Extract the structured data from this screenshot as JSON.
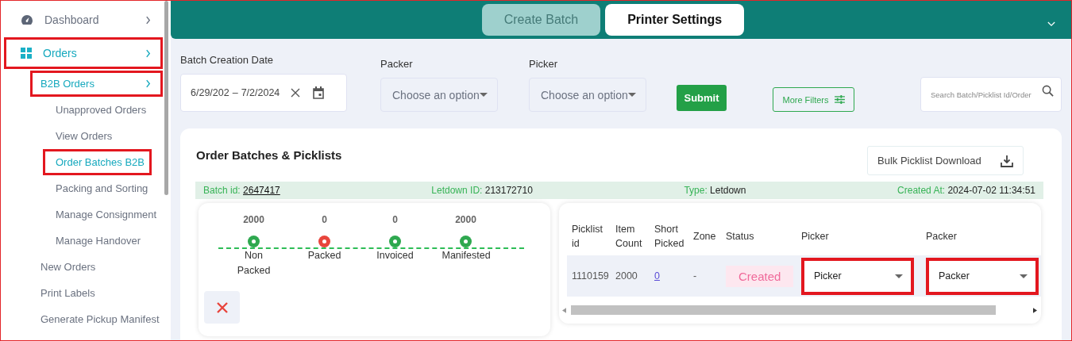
{
  "sidebar": {
    "items": [
      {
        "label": "Dashboard",
        "kind": "gauge",
        "selected": false,
        "highlighted": false,
        "expandable": true
      },
      {
        "label": "Orders",
        "kind": "grid",
        "selected": true,
        "highlighted": true,
        "expandable": true,
        "children": [
          {
            "label": "B2B Orders",
            "selected": true,
            "highlighted": true,
            "expandable": true,
            "children": [
              {
                "label": "Unapproved Orders",
                "selected": false,
                "highlighted": false,
                "expandable": false
              },
              {
                "label": "View Orders",
                "selected": false,
                "highlighted": false,
                "expandable": false
              },
              {
                "label": "Order Batches B2B",
                "selected": true,
                "highlighted": true,
                "expandable": false
              },
              {
                "label": "Packing and Sorting",
                "selected": false,
                "highlighted": false,
                "expandable": false
              },
              {
                "label": "Manage Consignment",
                "selected": false,
                "highlighted": false,
                "expandable": false
              },
              {
                "label": "Manage Handover",
                "selected": false,
                "highlighted": false,
                "expandable": false
              }
            ]
          },
          {
            "label": "New Orders",
            "selected": false,
            "highlighted": false,
            "expandable": false
          },
          {
            "label": "Print Labels",
            "selected": false,
            "highlighted": false,
            "expandable": false
          },
          {
            "label": "Generate Pickup Manifest",
            "selected": false,
            "highlighted": false,
            "expandable": false
          }
        ]
      }
    ]
  },
  "header": {
    "tabs": [
      {
        "label": "Create Batch",
        "selected": false
      },
      {
        "label": "Printer Settings",
        "selected": true
      }
    ]
  },
  "filters": {
    "date_range": {
      "label": "Batch Creation Date",
      "start": "6/29/202",
      "separator": "–",
      "end": "7/2/2024"
    },
    "packer": {
      "label": "Packer",
      "placeholder": "Choose an option"
    },
    "picker": {
      "label": "Picker",
      "placeholder": "Choose an option"
    },
    "submit": "Submit",
    "more_filters": "More Filters",
    "search": {
      "placeholder": "Search Batch/Picklist Id/Order"
    }
  },
  "card": {
    "title": "Order Batches & Picklists",
    "bulk_download": "Bulk Picklist Download",
    "batch_info": [
      {
        "label": "Batch id:",
        "value": "2647417",
        "kind": "link"
      },
      {
        "label": "Letdown ID:",
        "value": "213172710",
        "kind": "text"
      },
      {
        "label": "Type:",
        "value": "Letdown",
        "kind": "text"
      },
      {
        "label": "Created At:",
        "value": "2024-07-02 11:34:51",
        "kind": "text"
      }
    ],
    "stages": [
      {
        "count": "2000",
        "label": "Non Packed",
        "color": "#2ea84f"
      },
      {
        "count": "0",
        "label": "Packed",
        "color": "#e8453c"
      },
      {
        "count": "0",
        "label": "Invoiced",
        "color": "#2ea84f"
      },
      {
        "count": "2000",
        "label": "Manifested",
        "color": "#2ea84f"
      }
    ],
    "table": {
      "columns": [
        "Picklist id",
        "Item Count",
        "Short Picked",
        "Zone",
        "Status",
        "Picker",
        "Packer"
      ],
      "rows": [
        {
          "picklist_id": "1110159",
          "item_count": "2000",
          "short_picked": "0",
          "zone": "-",
          "status": "Created",
          "picker": {
            "value": "Picker",
            "highlighted": true
          },
          "packer": {
            "value": "Packer",
            "highlighted": true
          }
        }
      ]
    }
  }
}
